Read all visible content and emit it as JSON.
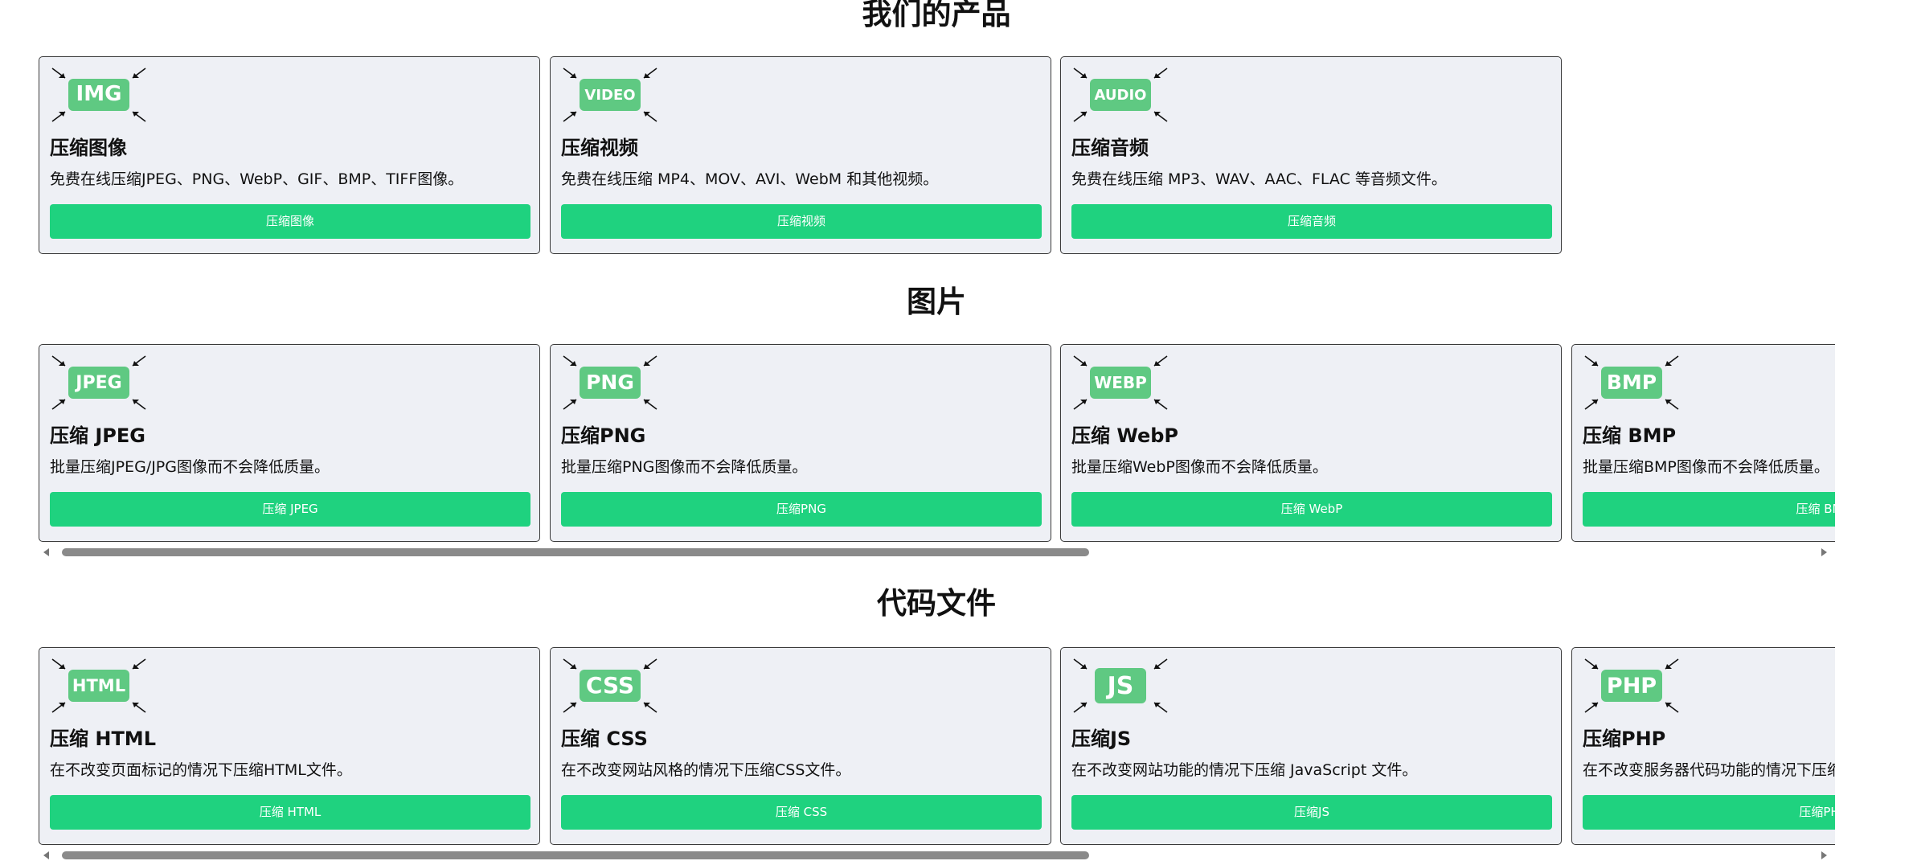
{
  "sections": [
    {
      "title": "我们的产品",
      "cards": [
        {
          "badge": "IMG",
          "title": "压缩图像",
          "desc": "免费在线压缩JPEG、PNG、WebP、GIF、BMP、TIFF图像。",
          "button": "压缩图像"
        },
        {
          "badge": "VIDEO",
          "title": "压缩视频",
          "desc": "免费在线压缩 MP4、MOV、AVI、WebM 和其他视频。",
          "button": "压缩视频"
        },
        {
          "badge": "AUDIO",
          "title": "压缩音频",
          "desc": "免费在线压缩 MP3、WAV、AAC、FLAC 等音频文件。",
          "button": "压缩音频"
        }
      ]
    },
    {
      "title": "图片",
      "cards": [
        {
          "badge": "JPEG",
          "title": "压缩 JPEG",
          "desc": "批量压缩JPEG/JPG图像而不会降低质量。",
          "button": "压缩 JPEG"
        },
        {
          "badge": "PNG",
          "title": "压缩PNG",
          "desc": "批量压缩PNG图像而不会降低质量。",
          "button": "压缩PNG"
        },
        {
          "badge": "WEBP",
          "title": "压缩 WebP",
          "desc": "批量压缩WebP图像而不会降低质量。",
          "button": "压缩 WebP"
        },
        {
          "badge": "BMP",
          "title": "压缩 BMP",
          "desc": "批量压缩BMP图像而不会降低质量。",
          "button": "压缩 BMP"
        }
      ]
    },
    {
      "title": "代码文件",
      "cards": [
        {
          "badge": "HTML",
          "title": "压缩 HTML",
          "desc": "在不改变页面标记的情况下压缩HTML文件。",
          "button": "压缩 HTML"
        },
        {
          "badge": "CSS",
          "title": "压缩 CSS",
          "desc": "在不改变网站风格的情况下压缩CSS文件。",
          "button": "压缩 CSS"
        },
        {
          "badge": "JS",
          "title": "压缩JS",
          "desc": "在不改变网站功能的情况下压缩 JavaScript 文件。",
          "button": "压缩JS"
        },
        {
          "badge": "PHP",
          "title": "压缩PHP",
          "desc": "在不改变服务器代码功能的情况下压缩PHP文件。",
          "button": "压缩PHP"
        }
      ]
    }
  ],
  "colors": {
    "accent": "#1fd27f",
    "badge": "#5fc982",
    "card_bg": "#eef0f5",
    "card_border": "#3a3a3a"
  },
  "icons": {
    "badge_arrows": "compress-arrows-icon"
  }
}
